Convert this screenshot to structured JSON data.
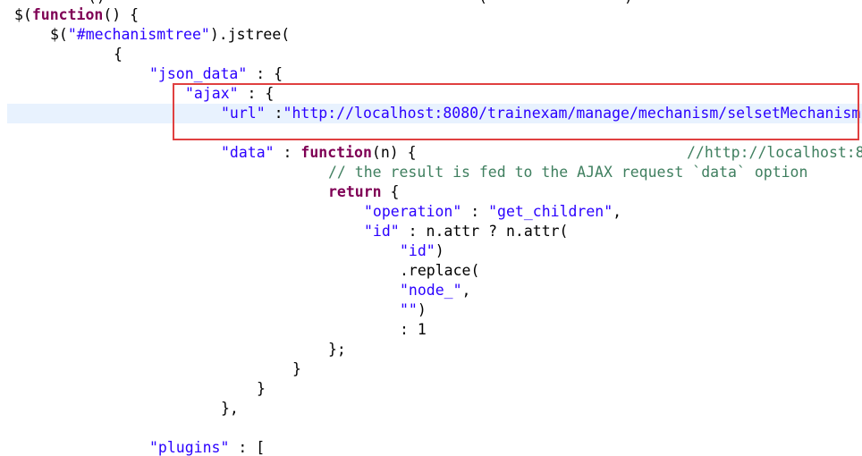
{
  "top_strip": {
    "frag_a": "()",
    "frag_b": "(",
    "frag_c": ")"
  },
  "code": {
    "l1_kw": "function",
    "l1_pre": "$(",
    "l1_post": "() {",
    "l2_pre": "$(",
    "l2_str": "\"#mechanismtree\"",
    "l2_post": ").jstree(",
    "l3": "{",
    "l4_str": "\"json_data\"",
    "l4_post": " : {",
    "l5_str": "\"ajax\"",
    "l5_post": " : {",
    "l6_str": "\"url\"",
    "l6_mid": " :",
    "l6_val": "\"http://localhost:8080/trainexam/manage/mechanism/selsetMechanism",
    "l8_str": "\"data\"",
    "l8_mid": " : ",
    "l8_kw": "function",
    "l8_post": "(n) {",
    "l8_comment": "//http://localhost:8",
    "l9_comment": "// the result is fed to the AJAX request `data` option",
    "l10_kw": "return",
    "l10_post": " {",
    "l11_str": "\"operation\"",
    "l11_mid": " : ",
    "l11_val": "\"get_children\"",
    "l11_post": ",",
    "l12_str": "\"id\"",
    "l12_post": " : n.attr ? n.attr(",
    "l13_str": "\"id\"",
    "l13_post": ")",
    "l14": ".replace(",
    "l15_str": "\"node_\"",
    "l15_post": ",",
    "l16_str": "\"\"",
    "l16_post": ")",
    "l17": ": 1",
    "l18": "};",
    "l19": "}",
    "l20": "}",
    "l21": "},",
    "l23_str": "\"plugins\"",
    "l23_post": " : ["
  }
}
